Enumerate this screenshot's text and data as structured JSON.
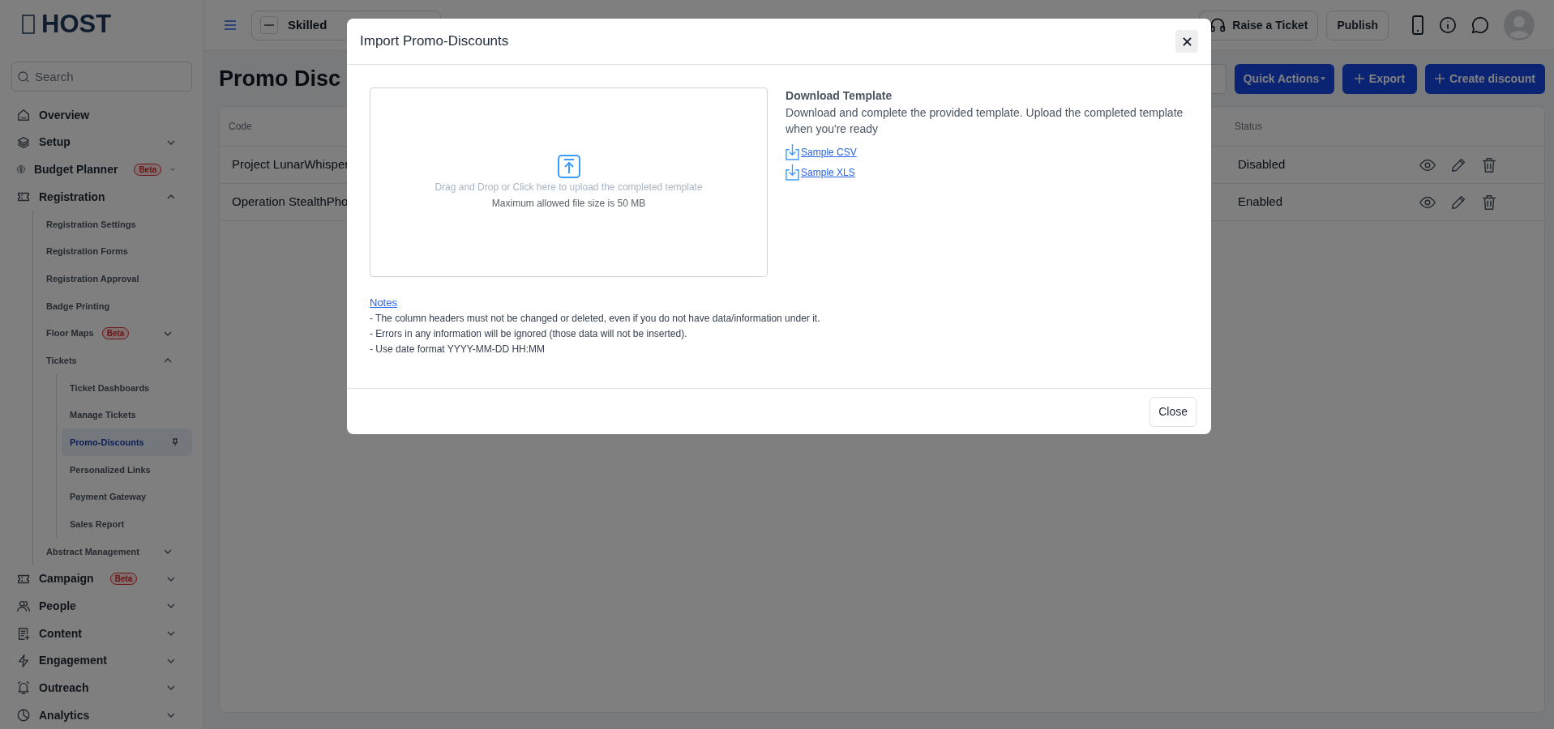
{
  "sidebar": {
    "logo": "HOST",
    "search": {
      "placeholder": "Search"
    },
    "items": [
      {
        "label": "Overview",
        "selected": false
      },
      {
        "label": "Setup",
        "selected": false,
        "expanded": false
      },
      {
        "label": "Budget Planner",
        "badge": "Beta",
        "selected": false,
        "expanded": false
      },
      {
        "label": "Registration",
        "selected": false,
        "expanded": true,
        "children": [
          {
            "label": "Registration Settings",
            "selected": false
          },
          {
            "label": "Registration Forms",
            "selected": false
          },
          {
            "label": "Registration Approval",
            "selected": false
          },
          {
            "label": "Badge Printing",
            "selected": false
          },
          {
            "label": "Floor Maps",
            "badge": "Beta",
            "selected": false,
            "expanded": false
          },
          {
            "label": "Tickets",
            "selected": false,
            "expanded": true,
            "children": [
              {
                "label": "Ticket Dashboards",
                "selected": false
              },
              {
                "label": "Manage Tickets",
                "selected": false
              },
              {
                "label": "Promo-Discounts",
                "selected": true,
                "pinned": true
              },
              {
                "label": "Personalized Links",
                "selected": false
              },
              {
                "label": "Payment Gateway",
                "selected": false
              },
              {
                "label": "Sales Report",
                "selected": false
              }
            ]
          },
          {
            "label": "Abstract Management",
            "selected": false,
            "expanded": false
          }
        ]
      },
      {
        "label": "Campaign",
        "badge": "Beta",
        "selected": false,
        "expanded": false
      },
      {
        "label": "People",
        "selected": false,
        "expanded": false
      },
      {
        "label": "Content",
        "selected": false,
        "expanded": false
      },
      {
        "label": "Engagement",
        "selected": false,
        "expanded": false
      },
      {
        "label": "Outreach",
        "selected": false,
        "expanded": false
      },
      {
        "label": "Analytics",
        "selected": false,
        "expanded": false
      }
    ]
  },
  "header": {
    "event": "Skilled",
    "buttons": [
      "Raise a Ticket",
      "Publish"
    ]
  },
  "page": {
    "title": "Promo Disc",
    "actions": [
      {
        "label": "Quick Actions",
        "kind": "dropdown"
      },
      {
        "label": "Export",
        "kind": "add"
      },
      {
        "label": "Create discount",
        "kind": "add"
      }
    ]
  },
  "table": {
    "columns": [
      "Code",
      "Status"
    ],
    "rows": [
      {
        "code": "Project LunarWhisper",
        "status": "Disabled"
      },
      {
        "code": "Operation StealthPho",
        "status": "Enabled"
      }
    ]
  },
  "modal": {
    "title": "Import Promo-Discounts",
    "dropzone": {
      "text": "Drag and Drop or Click here to upload the completed template",
      "note": "Maximum allowed file size is 50 MB"
    },
    "download": {
      "heading": "Download Template",
      "description": "Download and complete the provided template. Upload the completed template when you're ready",
      "links": [
        "Sample CSV",
        "Sample XLS"
      ]
    },
    "notes": {
      "link": "Notes",
      "lines": [
        "- The column headers must not be changed or deleted, even if you do not have data/information under it.",
        "- Errors in any information will be ignored (those data will not be inserted).",
        "- Use date format YYYY-MM-DD HH:MM"
      ]
    },
    "footer_button": "Close"
  }
}
